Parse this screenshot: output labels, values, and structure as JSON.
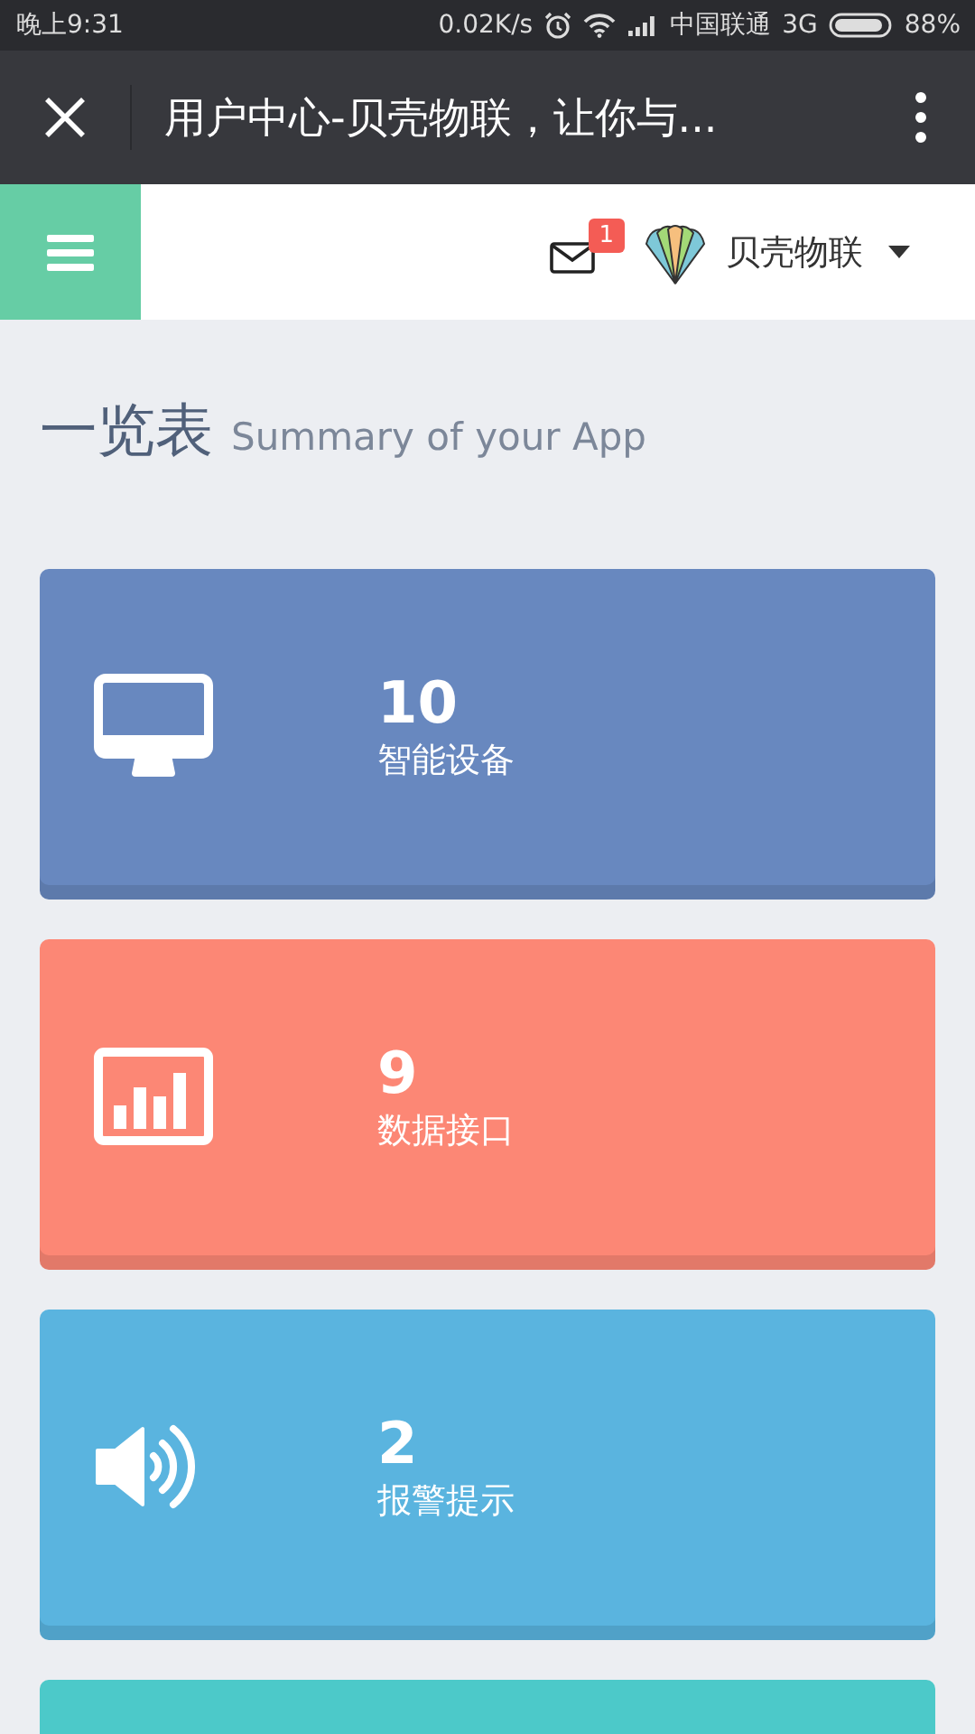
{
  "status_bar": {
    "time": "晚上9:31",
    "speed": "0.02K/s",
    "carrier": "中国联通",
    "network": "3G",
    "battery": "88%"
  },
  "title_bar": {
    "title": "用户中心-贝壳物联，让你与..."
  },
  "header": {
    "mail_badge": "1",
    "user": "贝壳物联"
  },
  "heading": {
    "title": "一览表",
    "subtitle": "Summary of your App"
  },
  "cards": [
    {
      "kind": "monitor",
      "color": "#6888bf",
      "count": "10",
      "label": "智能设备"
    },
    {
      "kind": "chart",
      "color": "#fc8775",
      "count": "9",
      "label": "数据接口"
    },
    {
      "kind": "speaker",
      "color": "#5ab4df",
      "count": "2",
      "label": "报警提示"
    },
    {
      "kind": "blank",
      "color": "#4cc9c9"
    }
  ]
}
